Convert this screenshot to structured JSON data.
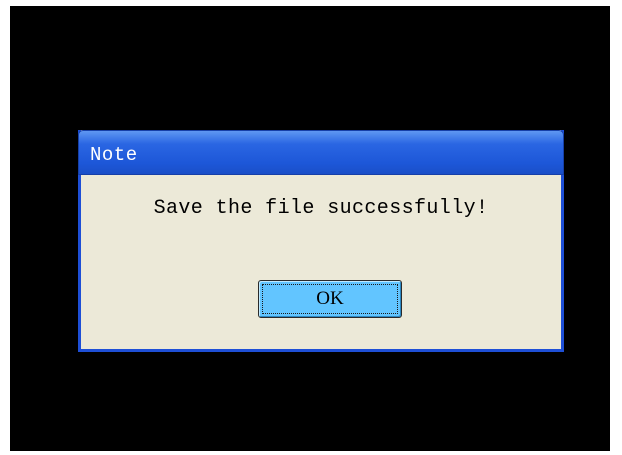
{
  "dialog": {
    "title": "Note",
    "message": "Save the file successfully!",
    "ok_label": "OK"
  },
  "colors": {
    "screen_background": "#000000",
    "title_bar": "#1d57d8",
    "dialog_body": "#ece9d8",
    "button_fill": "#62c5ff"
  }
}
